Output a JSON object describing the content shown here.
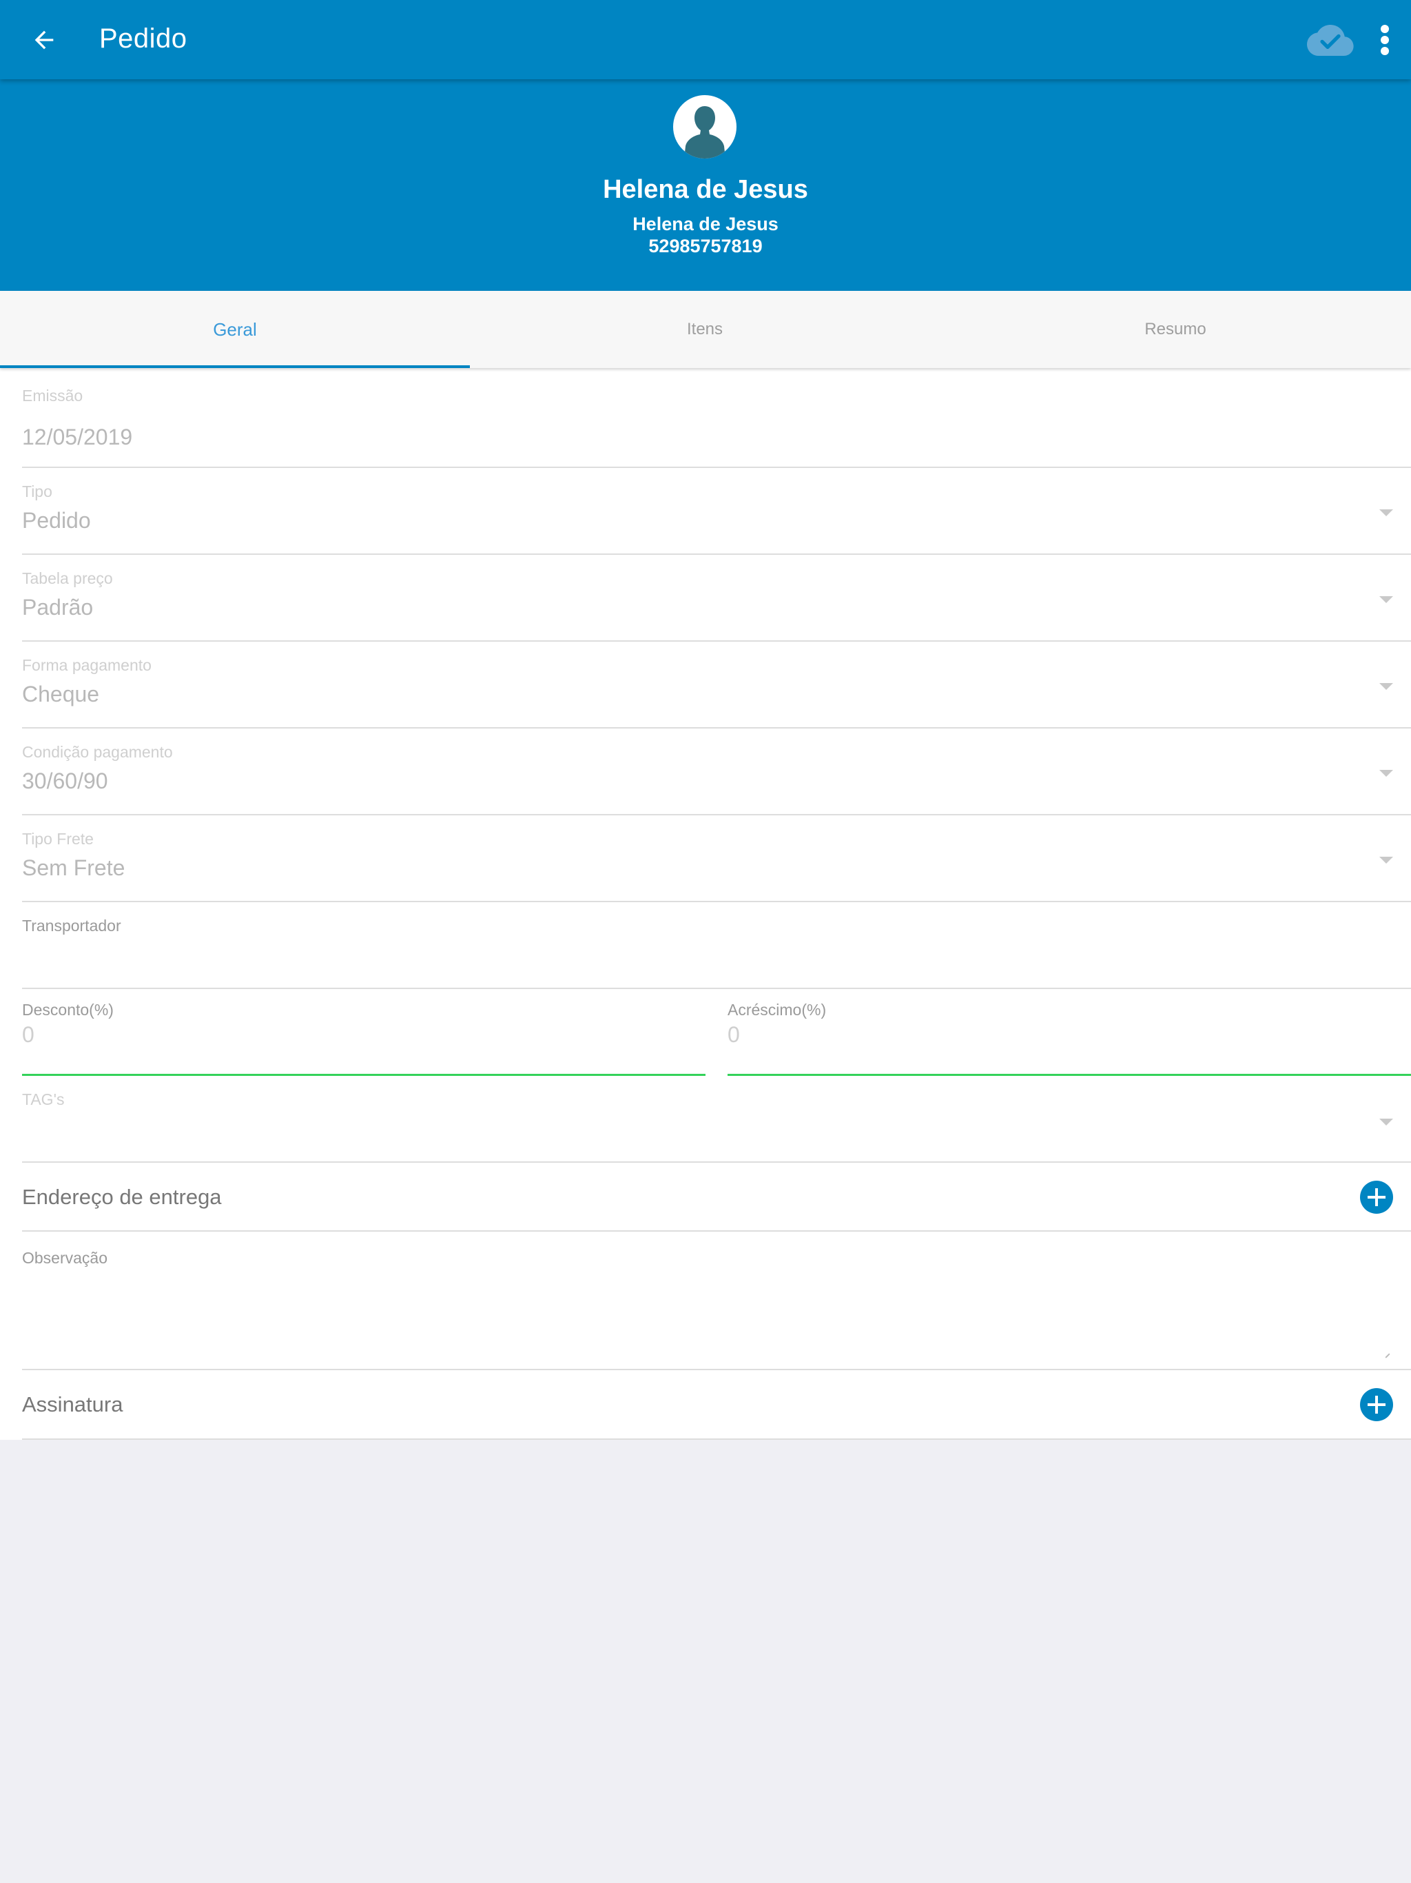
{
  "appbar": {
    "title": "Pedido",
    "back_icon": "arrow-left-icon",
    "sync_icon": "cloud-check-icon",
    "more_icon": "more-vertical-icon",
    "color": "#0085c2"
  },
  "customer": {
    "name": "Helena de Jesus",
    "subtitle": "Helena de Jesus",
    "document": "52985757819",
    "avatar_icon": "person-avatar-icon"
  },
  "tabs": [
    {
      "label": "Geral",
      "active": true
    },
    {
      "label": "Itens",
      "active": false
    },
    {
      "label": "Resumo",
      "active": false
    }
  ],
  "form": {
    "emissao": {
      "label": "Emissão",
      "value": "12/05/2019"
    },
    "tipo": {
      "label": "Tipo",
      "value": "Pedido"
    },
    "tabela_preco": {
      "label": "Tabela preço",
      "value": "Padrão"
    },
    "forma_pagamento": {
      "label": "Forma pagamento",
      "value": "Cheque"
    },
    "condicao_pagamento": {
      "label": "Condição pagamento",
      "value": "30/60/90"
    },
    "tipo_frete": {
      "label": "Tipo Frete",
      "value": "Sem Frete"
    },
    "transportador": {
      "label": "Transportador",
      "value": ""
    },
    "desconto": {
      "label": "Desconto(%)",
      "placeholder": "0"
    },
    "acrescimo": {
      "label": "Acréscimo(%)",
      "placeholder": "0"
    },
    "tags": {
      "label": "TAG's",
      "value": ""
    },
    "endereco_entrega": {
      "label": "Endereço de entrega"
    },
    "observacao": {
      "label": "Observação",
      "value": ""
    },
    "assinatura": {
      "label": "Assinatura"
    }
  },
  "colors": {
    "accent": "#0085c2",
    "valid_underline": "#34d25a",
    "background": "#efeff4"
  }
}
